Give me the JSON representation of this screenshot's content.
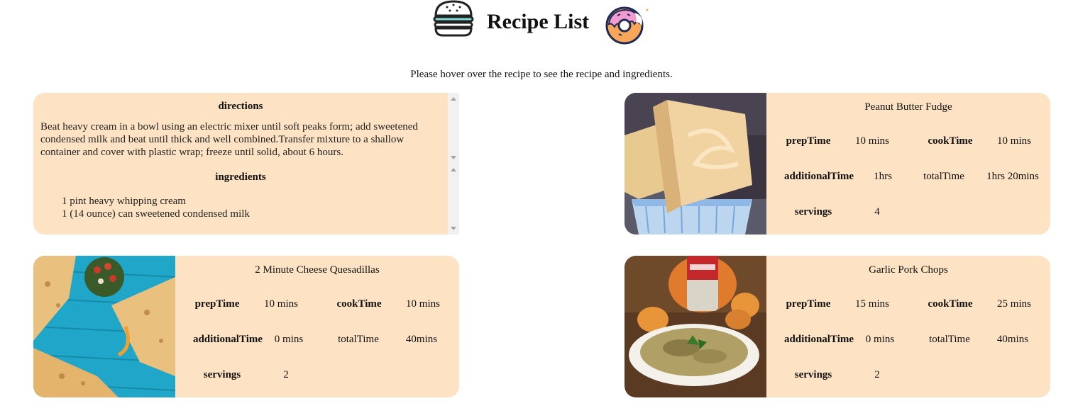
{
  "header": {
    "title": "Recipe List",
    "hint": "Please hover over the recipe to see the recipe and ingredients."
  },
  "icons": {
    "left": "burger-icon",
    "right": "donut-icon"
  },
  "colors": {
    "card_bg": "#fde3c3",
    "scroll_track": "#f1f1f1"
  },
  "hovered_card": {
    "directions_heading": "directions",
    "directions_text": "Beat heavy cream in a bowl using an electric mixer until soft peaks form; add sweetened condensed milk and beat until thick and well combined.Transfer mixture to a shallow container and cover with plastic wrap; freeze until solid, about 6 hours.",
    "ingredients_heading": "ingredients",
    "ingredients": [
      "1 pint heavy whipping cream",
      "1 (14 ounce) can sweetened condensed milk"
    ]
  },
  "labels": {
    "prep": "prepTime",
    "cook": "cookTime",
    "additional": "additionalTime",
    "total": "totalTime",
    "servings": "servings"
  },
  "recipes": [
    {
      "name": "Peanut Butter Fudge",
      "prepTime": "10 mins",
      "cookTime": "10 mins",
      "additionalTime": "1hrs",
      "totalTime": "1hrs 20mins",
      "servings": "4"
    },
    {
      "name": "2 Minute Cheese Quesadillas",
      "prepTime": "10 mins",
      "cookTime": "10 mins",
      "additionalTime": "0 mins",
      "totalTime": "40mins",
      "servings": "2"
    },
    {
      "name": "Garlic Pork Chops",
      "prepTime": "15 mins",
      "cookTime": "25 mins",
      "additionalTime": "0 mins",
      "totalTime": "40mins",
      "servings": "2"
    }
  ]
}
